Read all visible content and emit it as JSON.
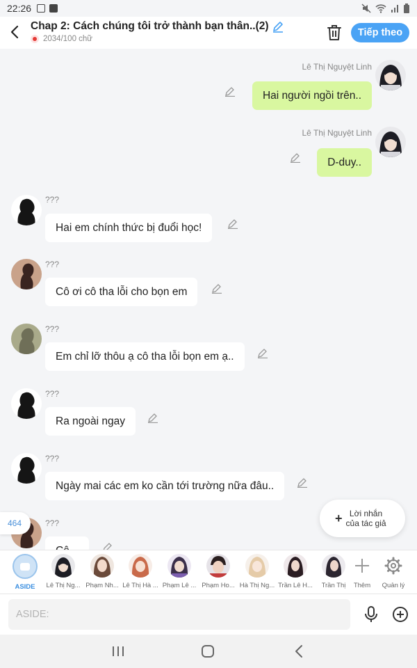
{
  "status_bar": {
    "time": "22:26"
  },
  "header": {
    "title": "Chap 2: Cách chúng tôi trở thành bạn thân..(2)",
    "word_count": "2034/100 chữ",
    "next_label": "Tiếp theo"
  },
  "messages": [
    {
      "side": "right",
      "sender": "Lê Thị Nguyệt Linh",
      "text": "Hai người ngồi trên.."
    },
    {
      "side": "right",
      "sender": "Lê Thị Nguyệt Linh",
      "text": "D-duy.."
    },
    {
      "side": "left",
      "sender": "???",
      "text": "Hai em chính thức bị đuổi học!"
    },
    {
      "side": "left",
      "sender": "???",
      "text": "Cô ơi cô tha lỗi cho bọn em"
    },
    {
      "side": "left",
      "sender": "???",
      "text": "Em chỉ lỡ thôu ạ cô tha lỗi bọn em ạ.."
    },
    {
      "side": "left",
      "sender": "???",
      "text": "Ra ngoài ngay"
    },
    {
      "side": "left",
      "sender": "???",
      "text": "Ngày mai các em ko cần tới trường nữa đâu.."
    },
    {
      "side": "left",
      "sender": "???",
      "text": "Cô..."
    }
  ],
  "floating": {
    "author_note_line1": "Lời nhắn",
    "author_note_line2": "của tác giả",
    "count": "464"
  },
  "characters": [
    {
      "name": "ASIDE"
    },
    {
      "name": "Lê Thị Ng..."
    },
    {
      "name": "Phạm Nh..."
    },
    {
      "name": "Lê Thị Hà ..."
    },
    {
      "name": "Phạm Lê ..."
    },
    {
      "name": "Phạm Ho..."
    },
    {
      "name": "Hà Thị Ng..."
    },
    {
      "name": "Trần Lê H..."
    },
    {
      "name": "Trần Thị"
    },
    {
      "name": "Thêm"
    },
    {
      "name": "Quản lý"
    }
  ],
  "input": {
    "placeholder": "ASIDE:"
  },
  "colors": {
    "accent": "#4aa3f5",
    "bubble_right": "#d9f7a0",
    "bubble_left": "#ffffff",
    "background": "#f4f5f7"
  }
}
